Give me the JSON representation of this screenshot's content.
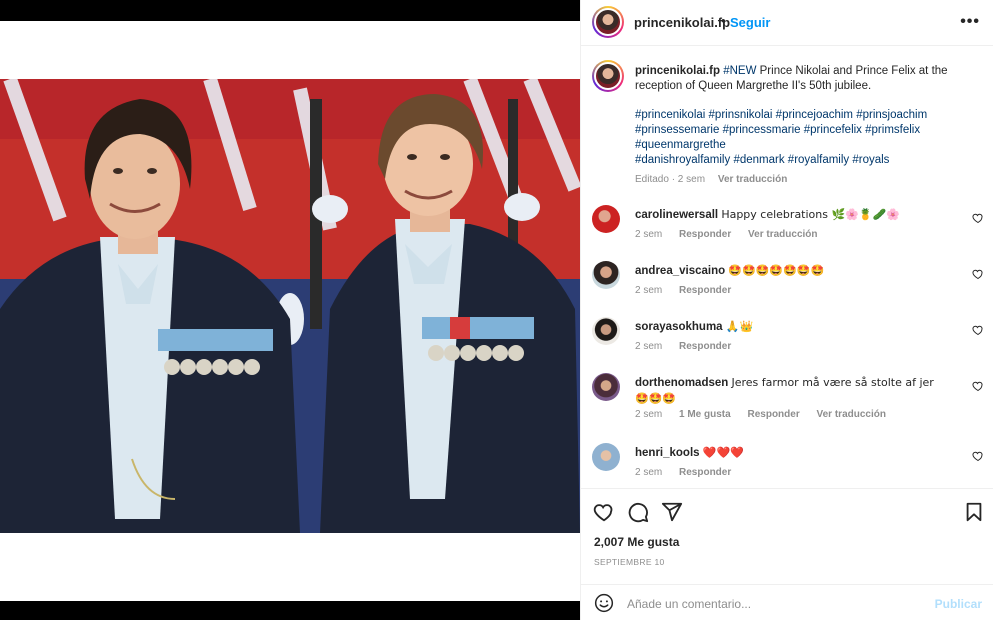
{
  "post": {
    "username": "princenikolai.fp",
    "dot": "•",
    "follow_label": "Seguir",
    "more_icon": "more-horizontal-icon"
  },
  "caption": {
    "username": "princenikolai.fp",
    "new_tag": "#NEW",
    "text": " Prince Nikolai and Prince Felix at the reception of Queen Margrethe II's 50th jubilee.",
    "hashtags": [
      "#princenikolai",
      "#prinsnikolai",
      "#princejoachim",
      "#prinsjoachim",
      "#prinsessemarie",
      "#princessmarie",
      "#princefelix",
      "#primsfelix",
      "#queenmargrethe",
      "#danishroyalfamily",
      "#denmark",
      "#royalfamily",
      "#royals"
    ],
    "edited": "Editado · 2 sem",
    "translate": "Ver traducción"
  },
  "comments": [
    {
      "user": "carolinewersall",
      "text": "Happy celebrations 🌿🌸🍍🥒🌸",
      "time": "2 sem",
      "reply": "Responder",
      "translate": "Ver traducción",
      "likes": ""
    },
    {
      "user": "andrea_viscaino",
      "text": "🤩🤩🤩🤩🤩🤩🤩",
      "time": "2 sem",
      "reply": "Responder",
      "translate": "",
      "likes": ""
    },
    {
      "user": "sorayasokhuma",
      "text": "🙏👑",
      "time": "2 sem",
      "reply": "Responder",
      "translate": "",
      "likes": ""
    },
    {
      "user": "dorthenomadsen",
      "text": "Jeres farmor må være så stolte af jer🤩🤩🤩",
      "time": "2 sem",
      "reply": "Responder",
      "translate": "Ver traducción",
      "likes": "1 Me gusta"
    },
    {
      "user": "henri_kools",
      "text": "❤️❤️❤️",
      "time": "2 sem",
      "reply": "Responder",
      "translate": "",
      "likes": ""
    }
  ],
  "actions": {
    "likes": "2,007 Me gusta",
    "date": "SEPTIEMBRE 10"
  },
  "add_comment": {
    "placeholder": "Añade un comentario...",
    "publish": "Publicar"
  },
  "colors": {
    "accent": "#0095f6",
    "tag": "#00376b",
    "muted": "#8e8e8e",
    "heart_red": "#ed4956"
  }
}
